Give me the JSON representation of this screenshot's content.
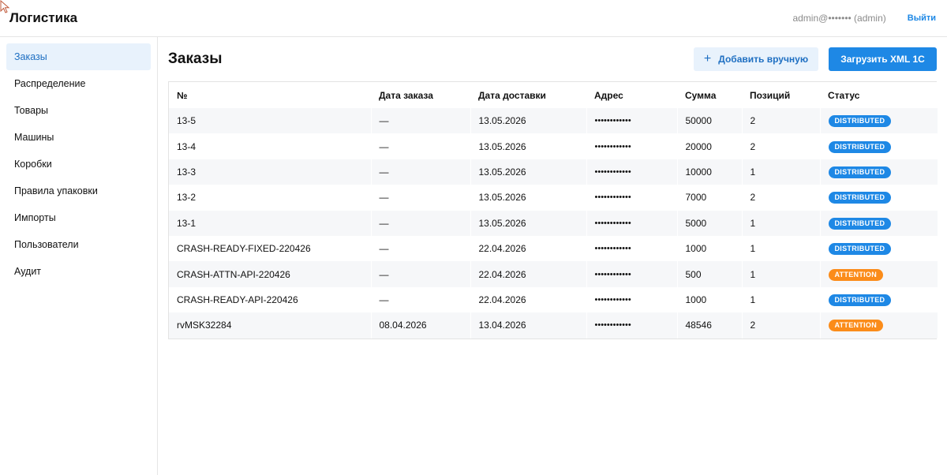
{
  "header": {
    "app_title": "Логистика",
    "user_label": "admin@••••••• (admin)",
    "logout_label": "Выйти"
  },
  "sidebar": {
    "items": [
      {
        "label": "Заказы",
        "active": true
      },
      {
        "label": "Распределение",
        "active": false
      },
      {
        "label": "Товары",
        "active": false
      },
      {
        "label": "Машины",
        "active": false
      },
      {
        "label": "Коробки",
        "active": false
      },
      {
        "label": "Правила упаковки",
        "active": false
      },
      {
        "label": "Импорты",
        "active": false
      },
      {
        "label": "Пользователи",
        "active": false
      },
      {
        "label": "Аудит",
        "active": false
      }
    ]
  },
  "main": {
    "title": "Заказы",
    "add_manual_label": "Добавить вручную",
    "add_manual_icon": "plus-icon",
    "upload_xml_label": "Загрузить XML 1C"
  },
  "table": {
    "columns": [
      "№",
      "Дата заказа",
      "Дата доставки",
      "Адрес",
      "Сумма",
      "Позиций",
      "Статус"
    ],
    "rows": [
      [
        "13-5",
        "—",
        "13.05.2026",
        "••••••••••••",
        "50000",
        "2",
        "DISTRIBUTED"
      ],
      [
        "13-4",
        "—",
        "13.05.2026",
        "••••••••••••",
        "20000",
        "2",
        "DISTRIBUTED"
      ],
      [
        "13-3",
        "—",
        "13.05.2026",
        "••••••••••••",
        "10000",
        "1",
        "DISTRIBUTED"
      ],
      [
        "13-2",
        "—",
        "13.05.2026",
        "••••••••••••",
        "7000",
        "2",
        "DISTRIBUTED"
      ],
      [
        "13-1",
        "—",
        "13.05.2026",
        "••••••••••••",
        "5000",
        "1",
        "DISTRIBUTED"
      ],
      [
        "CRASH-READY-FIXED-220426",
        "—",
        "22.04.2026",
        "••••••••••••",
        "1000",
        "1",
        "DISTRIBUTED"
      ],
      [
        "CRASH-ATTN-API-220426",
        "—",
        "22.04.2026",
        "••••••••••••",
        "500",
        "1",
        "ATTENTION"
      ],
      [
        "CRASH-READY-API-220426",
        "—",
        "22.04.2026",
        "••••••••••••",
        "1000",
        "1",
        "DISTRIBUTED"
      ],
      [
        "rvMSK32284",
        "08.04.2026",
        "13.04.2026",
        "••••••••••••",
        "48546",
        "2",
        "ATTENTION"
      ]
    ]
  },
  "colors": {
    "accent": "#1e88e5",
    "distributed": "#1e88e5",
    "attention": "#fb8c1a",
    "active_nav_bg": "#e8f2fc"
  }
}
